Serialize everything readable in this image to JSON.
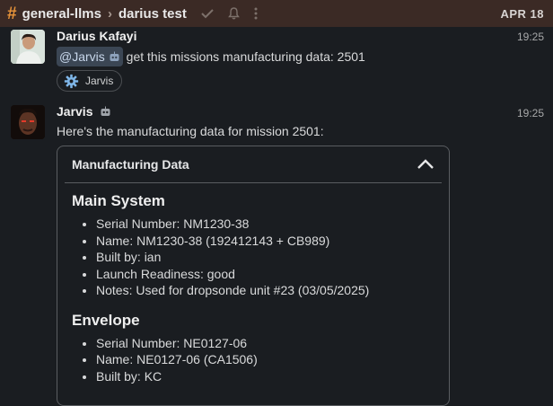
{
  "header": {
    "channel": "general-llms",
    "thread": "darius test",
    "date": "APR 18"
  },
  "messages": [
    {
      "author": "Darius Kafayi",
      "time": "19:25",
      "mention": "@Jarvis",
      "text": " get this missions manufacturing data: 2501",
      "chip_label": "Jarvis"
    },
    {
      "author": "Jarvis",
      "time": "19:25",
      "text": "Here's the manufacturing data for mission 2501:",
      "card": {
        "title": "Manufacturing Data",
        "sections": [
          {
            "title": "Main System",
            "items": [
              "Serial Number: NM1230-38",
              "Name: NM1230-38 (192412143 + CB989)",
              "Built by: ian",
              "Launch Readiness: good",
              "Notes: Used for dropsonde unit #23 (03/05/2025)"
            ]
          },
          {
            "title": "Envelope",
            "items": [
              "Serial Number: NE0127-06",
              "Name: NE0127-06 (CA1506)",
              "Built by: KC"
            ]
          }
        ]
      }
    }
  ],
  "icons": {
    "channel": "hash-icon",
    "separator": "chevron-right-icon",
    "check": "check-icon",
    "bell": "bell-icon",
    "menu": "more-vertical-icon",
    "bot": "robot-icon",
    "chip": "gear-icon",
    "collapse": "chevron-up-icon"
  },
  "colors": {
    "header_bg": "#3b2a25",
    "hash": "#e8943a",
    "background": "#1a1d21"
  }
}
